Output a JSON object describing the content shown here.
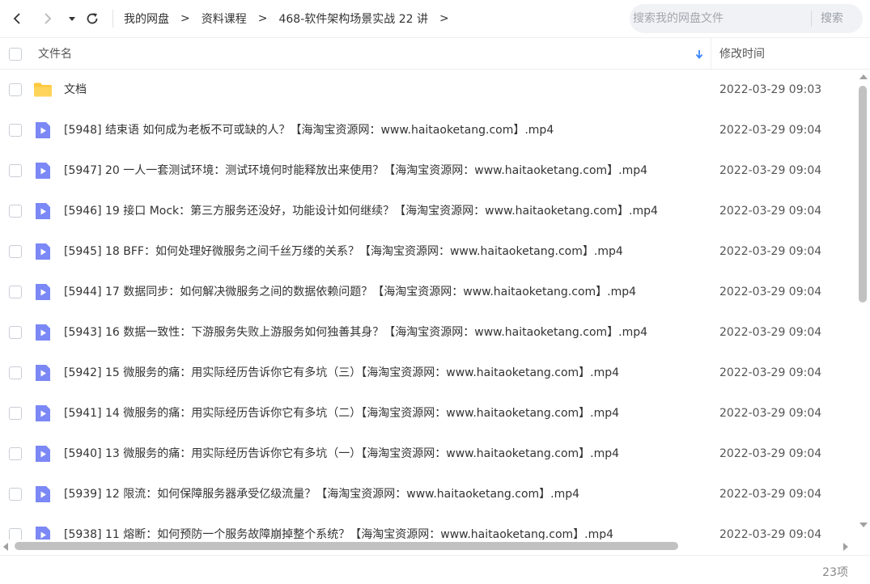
{
  "nav": {
    "back_icon": "chevron-left-icon",
    "forward_icon": "chevron-right-icon",
    "dropdown_icon": "caret-down-icon",
    "refresh_icon": "refresh-icon"
  },
  "breadcrumb": {
    "items": [
      "我的网盘",
      "资料课程",
      "468-软件架构场景实战 22 讲"
    ],
    "separator": ">"
  },
  "search": {
    "placeholder": "搜索我的网盘文件",
    "button_label": "搜索"
  },
  "columns": {
    "name": "文件名",
    "modified": "修改时间",
    "sort_icon": "sort-arrow-down-icon"
  },
  "files": [
    {
      "name": "文档",
      "time": "2022-03-29 09:03",
      "type": "folder"
    },
    {
      "name": "[5948] 结束语  如何成为老板不可或缺的人？【海淘宝资源网：www.haitaoketang.com】.mp4",
      "time": "2022-03-29 09:04",
      "type": "video"
    },
    {
      "name": "[5947] 20  一人一套测试环境：测试环境何时能释放出来使用？【海淘宝资源网：www.haitaoketang.com】.mp4",
      "time": "2022-03-29 09:04",
      "type": "video"
    },
    {
      "name": "[5946] 19  接口 Mock：第三方服务还没好，功能设计如何继续？【海淘宝资源网：www.haitaoketang.com】.mp4",
      "time": "2022-03-29 09:04",
      "type": "video"
    },
    {
      "name": "[5945] 18  BFF：如何处理好微服务之间千丝万缕的关系？【海淘宝资源网：www.haitaoketang.com】.mp4",
      "time": "2022-03-29 09:04",
      "type": "video"
    },
    {
      "name": "[5944] 17  数据同步：如何解决微服务之间的数据依赖问题？【海淘宝资源网：www.haitaoketang.com】.mp4",
      "time": "2022-03-29 09:04",
      "type": "video"
    },
    {
      "name": "[5943] 16  数据一致性：下游服务失败上游服务如何独善其身？【海淘宝资源网：www.haitaoketang.com】.mp4",
      "time": "2022-03-29 09:04",
      "type": "video"
    },
    {
      "name": "[5942] 15  微服务的痛：用实际经历告诉你它有多坑（三）【海淘宝资源网：www.haitaoketang.com】.mp4",
      "time": "2022-03-29 09:04",
      "type": "video"
    },
    {
      "name": "[5941] 14  微服务的痛：用实际经历告诉你它有多坑（二）【海淘宝资源网：www.haitaoketang.com】.mp4",
      "time": "2022-03-29 09:04",
      "type": "video"
    },
    {
      "name": "[5940] 13  微服务的痛：用实际经历告诉你它有多坑（一）【海淘宝资源网：www.haitaoketang.com】.mp4",
      "time": "2022-03-29 09:04",
      "type": "video"
    },
    {
      "name": "[5939] 12  限流：如何保障服务器承受亿级流量？【海淘宝资源网：www.haitaoketang.com】.mp4",
      "time": "2022-03-29 09:04",
      "type": "video"
    },
    {
      "name": "[5938] 11  熔断：如何预防一个服务故障崩掉整个系统？【海淘宝资源网：www.haitaoketang.com】.mp4",
      "time": "2022-03-29 09:04",
      "type": "video"
    }
  ],
  "footer": {
    "count": "23项"
  },
  "colors": {
    "folder": "#ffc93c",
    "video": "#7b88f6",
    "search_bg": "#f1f2f6",
    "accent": "#3a86ff"
  }
}
